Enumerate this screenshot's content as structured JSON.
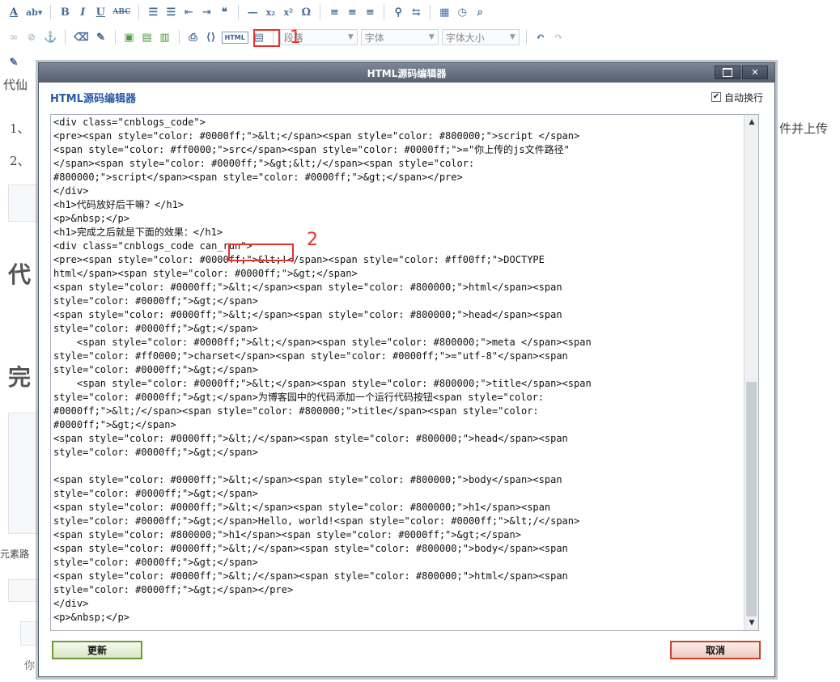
{
  "toolbar": {
    "paragraph": "段落",
    "font": "字体",
    "font_size": "字体大小",
    "html_button": "HTML"
  },
  "annotations": {
    "mark1": "1",
    "mark2": "2"
  },
  "background": {
    "t1": "代仙",
    "t2": "1、",
    "t3": "2、",
    "t4": "代",
    "t5": "完",
    "t6": "元素路",
    "t7": "件并上传",
    "t8": "你"
  },
  "modal": {
    "window_title": "HTML源码编辑器",
    "heading": "HTML源码编辑器",
    "wrap_label": "自动换行",
    "wrap_checked": true,
    "update_button": "更新",
    "cancel_button": "取消",
    "code_lines": [
      "<div class=\"cnblogs_code\">",
      "<pre><span style=\"color: #0000ff;\">&lt;</span><span style=\"color: #800000;\">script </span>",
      "<span style=\"color: #ff0000;\">src</span><span style=\"color: #0000ff;\">=\"你上传的js文件路径\"",
      "</span><span style=\"color: #0000ff;\">&gt;&lt;/</span><span style=\"color:",
      "#800000;\">script</span><span style=\"color: #0000ff;\">&gt;</span></pre>",
      "</div>",
      "<h1>代码放好后干嘛？</h1>",
      "<p>&nbsp;</p>",
      "<h1>完成之后就是下面的效果：</h1>",
      "<div class=\"cnblogs_code can_run\">",
      "<pre><span style=\"color: #0000ff;\">&lt;!</span><span style=\"color: #ff00ff;\">DOCTYPE",
      "html</span><span style=\"color: #0000ff;\">&gt;</span>",
      "<span style=\"color: #0000ff;\">&lt;</span><span style=\"color: #800000;\">html</span><span",
      "style=\"color: #0000ff;\">&gt;</span>",
      "<span style=\"color: #0000ff;\">&lt;</span><span style=\"color: #800000;\">head</span><span",
      "style=\"color: #0000ff;\">&gt;</span>",
      "    <span style=\"color: #0000ff;\">&lt;</span><span style=\"color: #800000;\">meta </span><span",
      "style=\"color: #ff0000;\">charset</span><span style=\"color: #0000ff;\">=\"utf-8\"</span><span",
      "style=\"color: #0000ff;\">&gt;</span>",
      "    <span style=\"color: #0000ff;\">&lt;</span><span style=\"color: #800000;\">title</span><span",
      "style=\"color: #0000ff;\">&gt;</span>为博客园中的代码添加一个运行代码按钮<span style=\"color:",
      "#0000ff;\">&lt;/</span><span style=\"color: #800000;\">title</span><span style=\"color:",
      "#0000ff;\">&gt;</span>",
      "<span style=\"color: #0000ff;\">&lt;/</span><span style=\"color: #800000;\">head</span><span",
      "style=\"color: #0000ff;\">&gt;</span>",
      "",
      "<span style=\"color: #0000ff;\">&lt;</span><span style=\"color: #800000;\">body</span><span",
      "style=\"color: #0000ff;\">&gt;</span>",
      "<span style=\"color: #0000ff;\">&lt;</span><span style=\"color: #800000;\">h1</span><span",
      "style=\"color: #0000ff;\">&gt;</span>Hello, world!<span style=\"color: #0000ff;\">&lt;/</span>",
      "<span style=\"color: #800000;\">h1</span><span style=\"color: #0000ff;\">&gt;</span>",
      "<span style=\"color: #0000ff;\">&lt;/</span><span style=\"color: #800000;\">body</span><span",
      "style=\"color: #0000ff;\">&gt;</span>",
      "<span style=\"color: #0000ff;\">&lt;/</span><span style=\"color: #800000;\">html</span><span",
      "style=\"color: #0000ff;\">&gt;</span></pre>",
      "</div>",
      "<p>&nbsp;</p>"
    ]
  }
}
